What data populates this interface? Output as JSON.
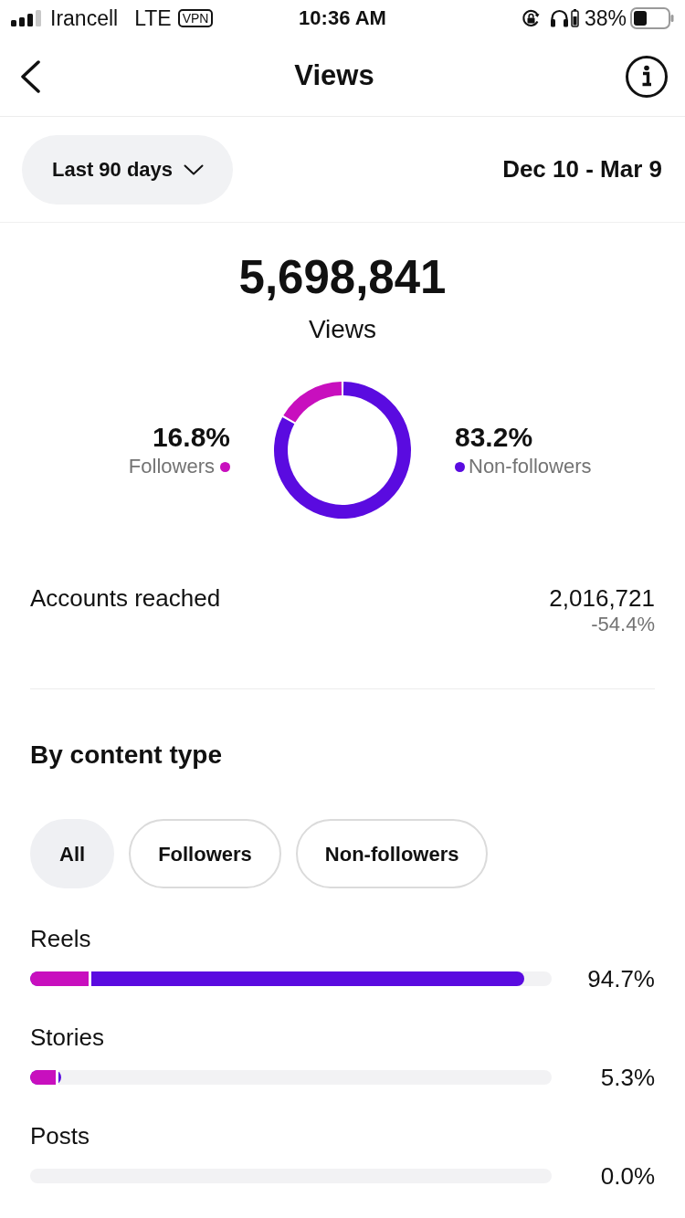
{
  "status_bar": {
    "carrier": "Irancell",
    "network": "LTE",
    "vpn": "VPN",
    "time": "10:36 AM",
    "battery": "38%"
  },
  "nav": {
    "title": "Views"
  },
  "filter": {
    "range": "Last 90 days",
    "dates": "Dec 10 - Mar 9"
  },
  "summary": {
    "total": "5,698,841",
    "label": "Views",
    "chart_data": {
      "type": "donut",
      "categories": [
        "Followers",
        "Non-followers"
      ],
      "values": [
        16.8,
        83.2
      ]
    },
    "legend": [
      {
        "percent": "16.8%",
        "color": "#c80fbe"
      },
      {
        "percent": "83.2%",
        "color": "#5a0be0"
      }
    ]
  },
  "accounts_reached": {
    "label": "Accounts reached",
    "value": "2,016,721",
    "change": "-54.4%"
  },
  "content_type": {
    "title": "By content type",
    "tabs": [
      {
        "label": "All",
        "selected": true
      },
      {
        "label": "Followers",
        "selected": false
      },
      {
        "label": "Non-followers",
        "selected": false
      }
    ],
    "rows": [
      {
        "label": "Reels",
        "percent": "94.7%",
        "segments": [
          {
            "level": 0.112,
            "color": "#c80fbe"
          },
          {
            "level": 0.947,
            "color": "#5a0be0"
          }
        ]
      },
      {
        "label": "Stories",
        "percent": "5.3%",
        "segments": [
          {
            "level": 0.049,
            "color": "#c80fbe"
          },
          {
            "level": 0.059,
            "color": "#5a0be0"
          }
        ]
      },
      {
        "label": "Posts",
        "percent": "0.0%"
      }
    ]
  }
}
